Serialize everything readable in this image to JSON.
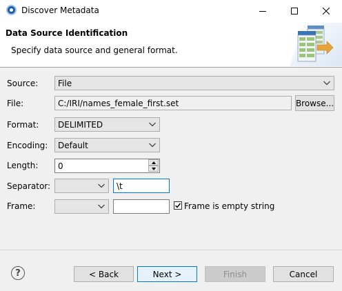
{
  "window": {
    "title": "Discover Metadata"
  },
  "banner": {
    "title": "Data Source Identification",
    "subtitle": "Specify data source and general format."
  },
  "form": {
    "source": {
      "label": "Source:",
      "value": "File"
    },
    "file": {
      "label": "File:",
      "value": "C:/IRI/names_female_first.set",
      "browse_label": "Browse..."
    },
    "format": {
      "label": "Format:",
      "value": "DELIMITED"
    },
    "encoding": {
      "label": "Encoding:",
      "value": "Default"
    },
    "length": {
      "label": "Length:",
      "value": "0"
    },
    "separator": {
      "label": "Separator:",
      "combo_value": "",
      "text_value": "\\t"
    },
    "frame": {
      "label": "Frame:",
      "combo_value": "",
      "text_value": "",
      "checkbox_label": "Frame is empty string",
      "checked": true
    }
  },
  "footer": {
    "help_symbol": "?",
    "back_label": "< Back",
    "next_label": "Next >",
    "finish_label": "Finish",
    "cancel_label": "Cancel"
  },
  "colors": {
    "accent": "#0078d7",
    "window_bg": "#f0f0f0",
    "disabled_text": "#8d8d8d"
  }
}
